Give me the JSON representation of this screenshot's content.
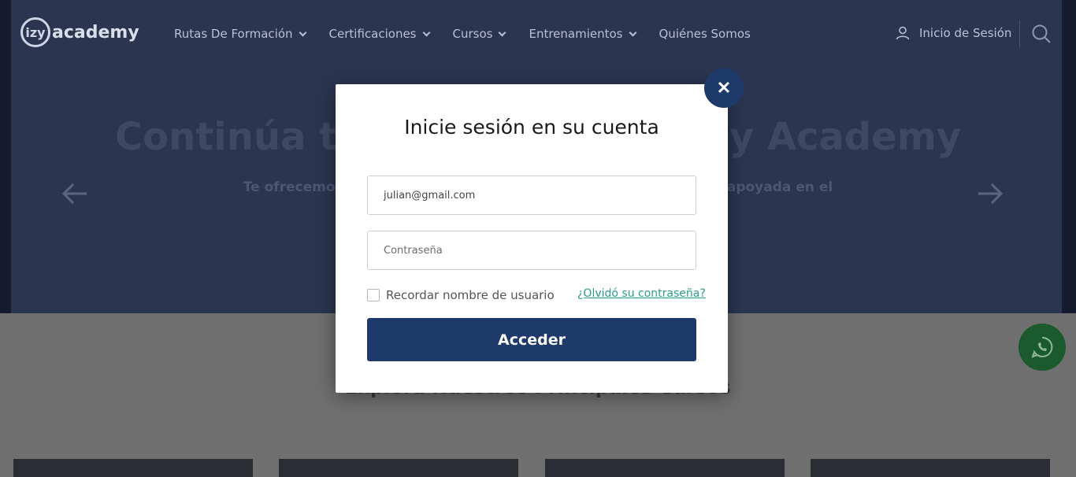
{
  "nav": {
    "logo_mark": "izy",
    "logo_text": "academy",
    "items": [
      {
        "label": "Rutas De Formación"
      },
      {
        "label": "Certificaciones"
      },
      {
        "label": "Cursos"
      },
      {
        "label": "Entrenamientos"
      },
      {
        "label": "Quiénes Somos"
      }
    ],
    "login_label": "Inicio de Sesión"
  },
  "hero": {
    "title": "Continúa tu formación con Izy Academy",
    "subtitle": "Te ofrecemos una formación profesional orientada a proyectos, apoyada en el desarrollo práctico y colaborativo."
  },
  "section": {
    "title": "Explora Nuestros Principales Cursos"
  },
  "modal": {
    "title": "Inicie sesión en su cuenta",
    "email_value": "julian@gmail.com",
    "password_placeholder": "Contraseña",
    "remember_label": "Recordar nombre de usuario",
    "forgot_label": "¿Olvidó su contraseña?",
    "submit_label": "Acceder",
    "close_glyph": "✕"
  },
  "colors": {
    "primary": "#1d3a6b",
    "link": "#2a9d8f",
    "whatsapp": "#1a5a2c"
  }
}
